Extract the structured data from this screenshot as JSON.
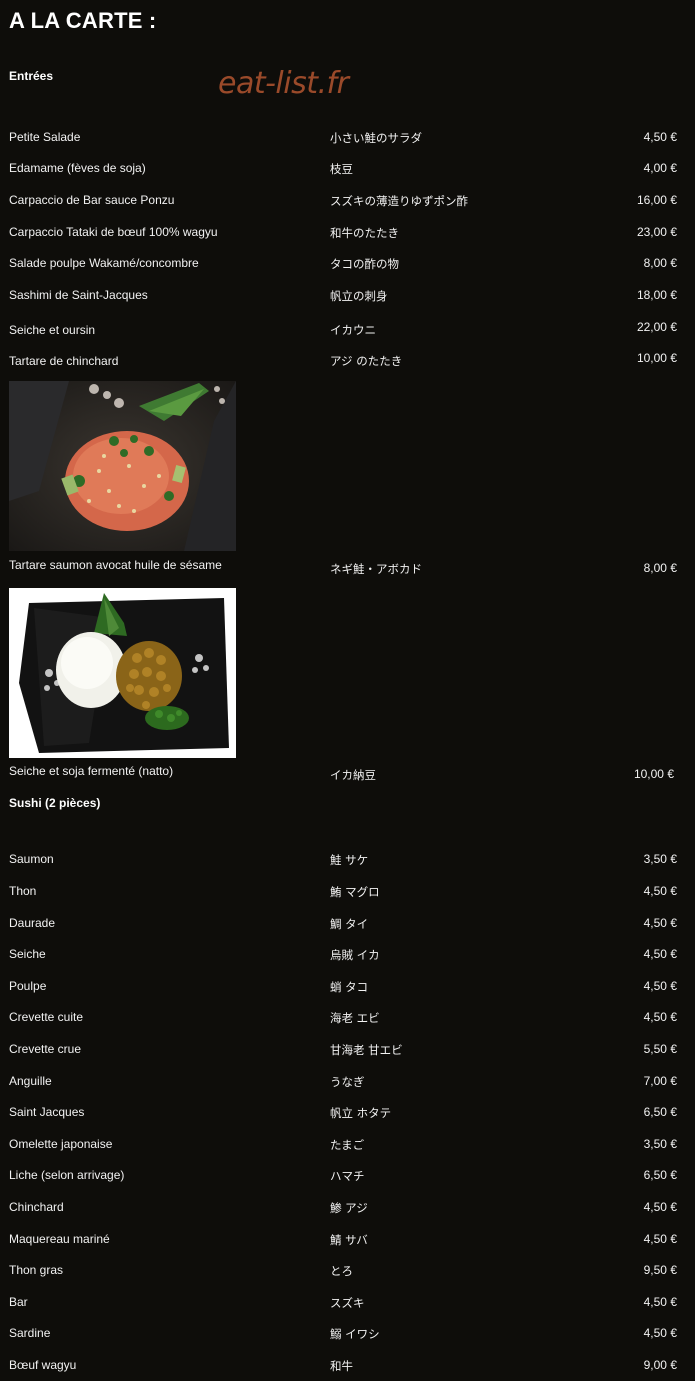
{
  "page": {
    "title": "A LA CARTE :",
    "watermark": "eat-list.fr"
  },
  "sections": {
    "entrees": "Entrées",
    "sushi": "Sushi (2 pièces)"
  },
  "entrees": [
    {
      "fr": "Petite Salade",
      "jp": "小さい鮭のサラダ",
      "price": "4,50 €"
    },
    {
      "fr": "Edamame (fèves de soja)",
      "jp": "枝豆",
      "price": "4,00 €"
    },
    {
      "fr": "Carpaccio de Bar sauce Ponzu",
      "jp": "スズキの薄造りゆずポン酢",
      "price": "16,00 €"
    },
    {
      "fr": "Carpaccio Tataki de bœuf 100% wagyu",
      "jp": "和牛のたたき",
      "price": "23,00 €"
    },
    {
      "fr": "Salade poulpe Wakamé/concombre",
      "jp": "タコの酢の物",
      "price": "8,00 €"
    },
    {
      "fr": "Sashimi de Saint-Jacques",
      "jp": "帆立の刺身",
      "price": "18,00 €"
    },
    {
      "fr": "Seiche et oursin",
      "jp": "イカウニ",
      "price": "22,00 €"
    },
    {
      "fr": "Tartare de chinchard",
      "jp": "アジ のたたき",
      "price": "10,00 €"
    },
    {
      "fr": "Tartare saumon avocat huile de sésame",
      "jp": "ネギ鮭・アボカド",
      "price": "8,00 €"
    },
    {
      "fr": "Seiche et soja fermenté (natto)",
      "jp": "イカ納豆",
      "price": "10,00 €"
    }
  ],
  "sushi": [
    {
      "fr": "Saumon",
      "jp": "鮭 サケ",
      "price": "3,50 €"
    },
    {
      "fr": "Thon",
      "jp": "鮪 マグロ",
      "price": "4,50 €"
    },
    {
      "fr": "Daurade",
      "jp": "鯛 タイ",
      "price": "4,50 €"
    },
    {
      "fr": "Seiche",
      "jp": "烏賊 イカ",
      "price": "4,50 €"
    },
    {
      "fr": "Poulpe",
      "jp": "蛸 タコ",
      "price": "4,50 €"
    },
    {
      "fr": "Crevette cuite",
      "jp": "海老 エビ",
      "price": "4,50 €"
    },
    {
      "fr": "Crevette crue",
      "jp": "甘海老 甘エビ",
      "price": "5,50 €"
    },
    {
      "fr": "Anguille",
      "jp": "うなぎ",
      "price": "7,00 €"
    },
    {
      "fr": "Saint Jacques",
      "jp": "帆立 ホタテ",
      "price": "6,50 €"
    },
    {
      "fr": "Omelette japonaise",
      "jp": "たまご",
      "price": "3,50 €"
    },
    {
      "fr": "Liche (selon arrivage)",
      "jp": "ハマチ",
      "price": "6,50 €"
    },
    {
      "fr": "Chinchard",
      "jp": "鯵 アジ",
      "price": "4,50 €"
    },
    {
      "fr": "Maquereau mariné",
      "jp": "鯖 サバ",
      "price": "4,50 €"
    },
    {
      "fr": "Thon gras",
      "jp": "とろ",
      "price": "9,50 €"
    },
    {
      "fr": "Bar",
      "jp": "スズキ",
      "price": "4,50 €"
    },
    {
      "fr": "Sardine",
      "jp": "鰯 イワシ",
      "price": "4,50 €"
    },
    {
      "fr": "Bœuf wagyu",
      "jp": "和牛",
      "price": "9,00 €"
    }
  ]
}
